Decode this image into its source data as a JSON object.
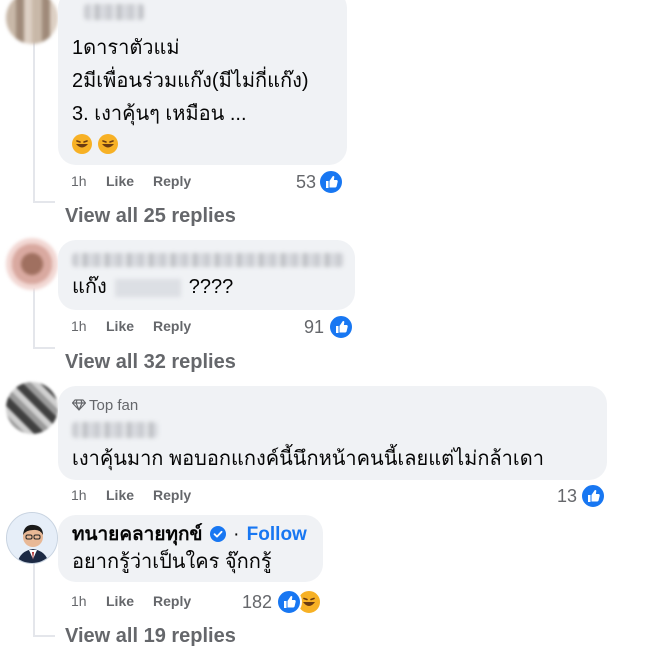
{
  "comments": [
    {
      "lines": [
        "1ดาราตัวแม่",
        "2มีเพื่อนร่วมแก๊ง(มีไม่กี่แก๊ง)",
        "3. เงาคุ้นๆ เหมือน ..."
      ],
      "emoji": "🤣🤣",
      "time": "1h",
      "like_label": "Like",
      "reply_label": "Reply",
      "reaction_count": "53",
      "view_replies": "View all 25 replies"
    },
    {
      "text_prefix": "แก๊ง",
      "text_suffix": "????",
      "time": "1h",
      "like_label": "Like",
      "reply_label": "Reply",
      "reaction_count": "91",
      "view_replies": "View all 32 replies"
    },
    {
      "badge": "Top fan",
      "text": "เงาคุ้นมาก พอบอกแกงค์นี้นึกหน้าคนนี้เลยแต่ไม่กล้าเดา",
      "time": "1h",
      "like_label": "Like",
      "reply_label": "Reply",
      "reaction_count": "13"
    },
    {
      "author": "ทนายคลายทุกข์",
      "follow_label": "Follow",
      "separator": "·",
      "text": "อยากรู้ว่าเป็นใคร จุ๊กกรู้",
      "time": "1h",
      "like_label": "Like",
      "reply_label": "Reply",
      "reaction_count": "182",
      "view_replies": "View all 19 replies"
    }
  ],
  "colors": {
    "like_blue": "#1877f2",
    "haha_yellow": "#f7b125",
    "bubble": "#f0f2f5",
    "meta_gray": "#65676b"
  }
}
